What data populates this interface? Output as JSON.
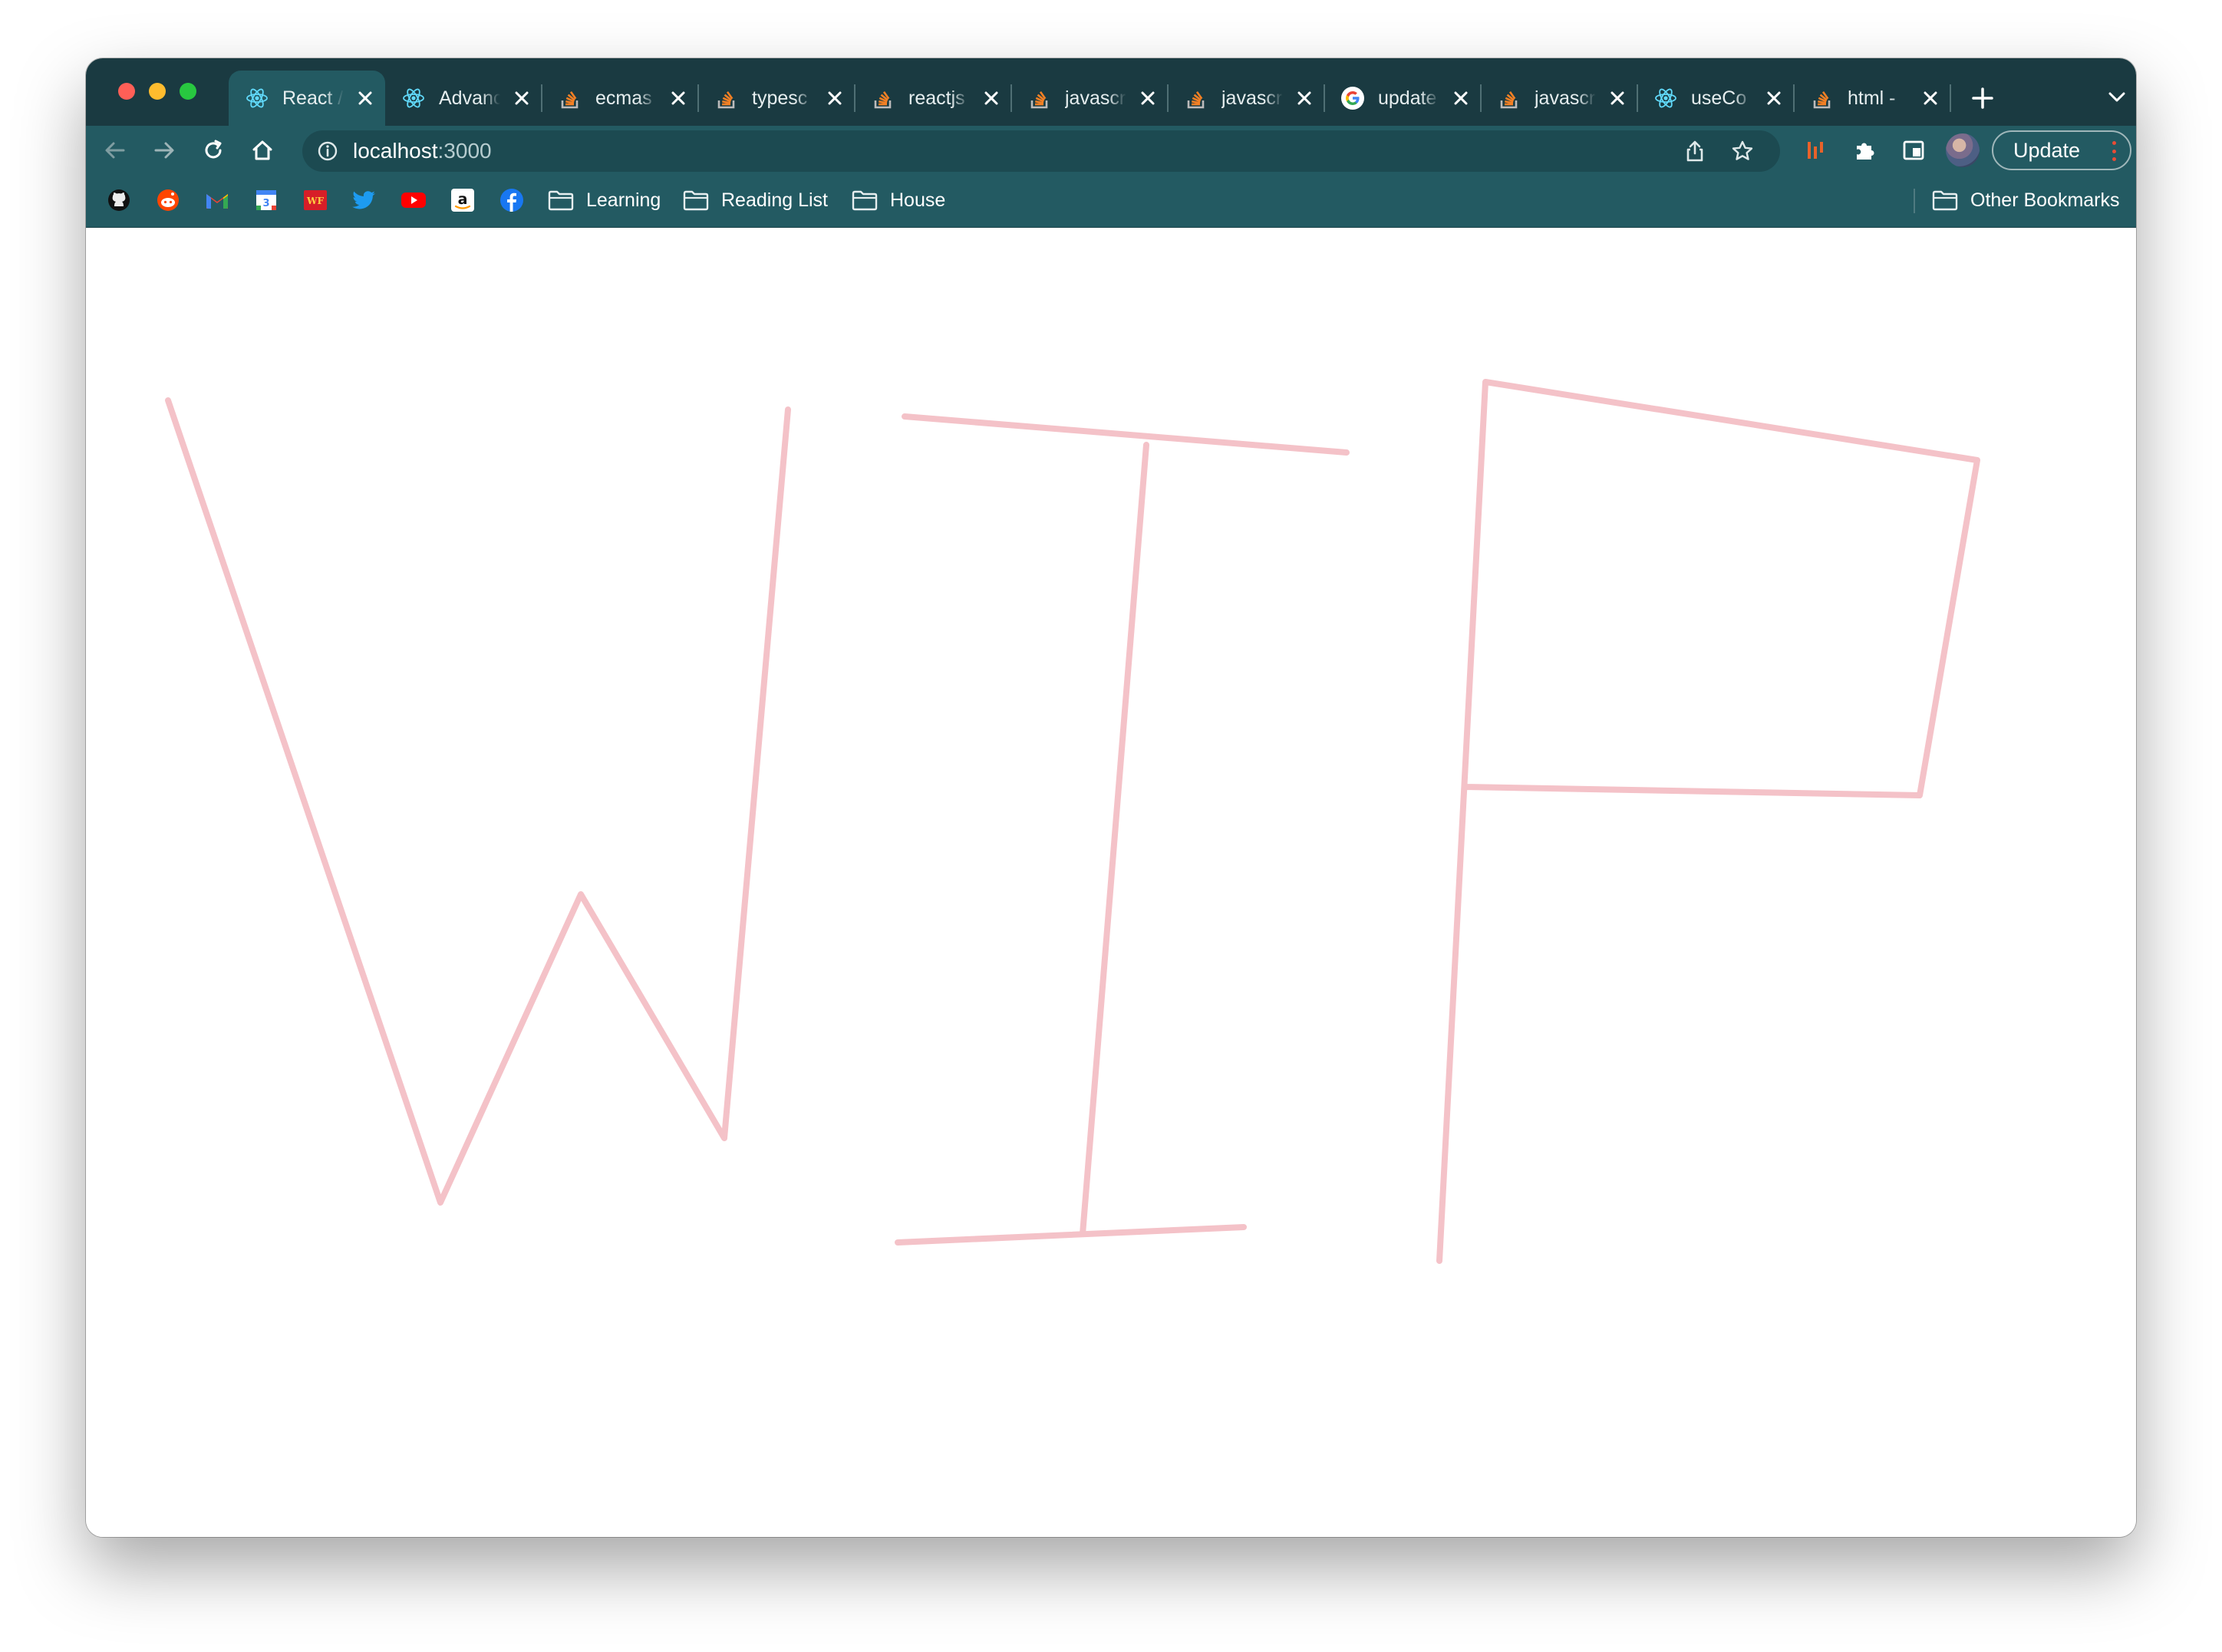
{
  "window": {
    "traffic_lights": [
      "close",
      "minimize",
      "maximize"
    ]
  },
  "tabs": [
    {
      "label": "React /",
      "icon": "react-icon",
      "icon_color": "#61dafb",
      "active": true
    },
    {
      "label": "Advanc",
      "icon": "react-icon",
      "icon_color": "#61dafb",
      "active": false
    },
    {
      "label": "ecmas",
      "icon": "stackoverflow-icon",
      "icon_color": "#f48024",
      "active": false
    },
    {
      "label": "typesc",
      "icon": "stackoverflow-icon",
      "icon_color": "#f48024",
      "active": false
    },
    {
      "label": "reactjs",
      "icon": "stackoverflow-icon",
      "icon_color": "#f48024",
      "active": false
    },
    {
      "label": "javascr",
      "icon": "stackoverflow-icon",
      "icon_color": "#f48024",
      "active": false
    },
    {
      "label": "javascr",
      "icon": "stackoverflow-icon",
      "icon_color": "#f48024",
      "active": false
    },
    {
      "label": "update",
      "icon": "google-icon",
      "icon_color": "#4285f4",
      "active": false
    },
    {
      "label": "javascr",
      "icon": "stackoverflow-icon",
      "icon_color": "#f48024",
      "active": false
    },
    {
      "label": "useCo",
      "icon": "react-icon",
      "icon_color": "#61dafb",
      "active": false
    },
    {
      "label": "html -",
      "icon": "stackoverflow-icon",
      "icon_color": "#f48024",
      "active": false
    }
  ],
  "toolbar": {
    "url_host": "localhost",
    "url_port": ":3000",
    "update_label": "Update"
  },
  "bookmarks": {
    "icons": [
      "github-icon",
      "reddit-icon",
      "gmail-icon",
      "google-calendar-icon",
      "wf-icon",
      "twitter-icon",
      "youtube-icon",
      "amazon-icon",
      "facebook-icon"
    ],
    "folders": [
      "Learning",
      "Reading List",
      "House"
    ],
    "other_label": "Other Bookmarks"
  },
  "canvas": {
    "stroke_color": "#f4c2c8",
    "drawing": "WIP"
  },
  "colors": {
    "tabstrip": "#1a3a41",
    "toolbar": "#235a62",
    "omnibox": "#1c4a51"
  }
}
